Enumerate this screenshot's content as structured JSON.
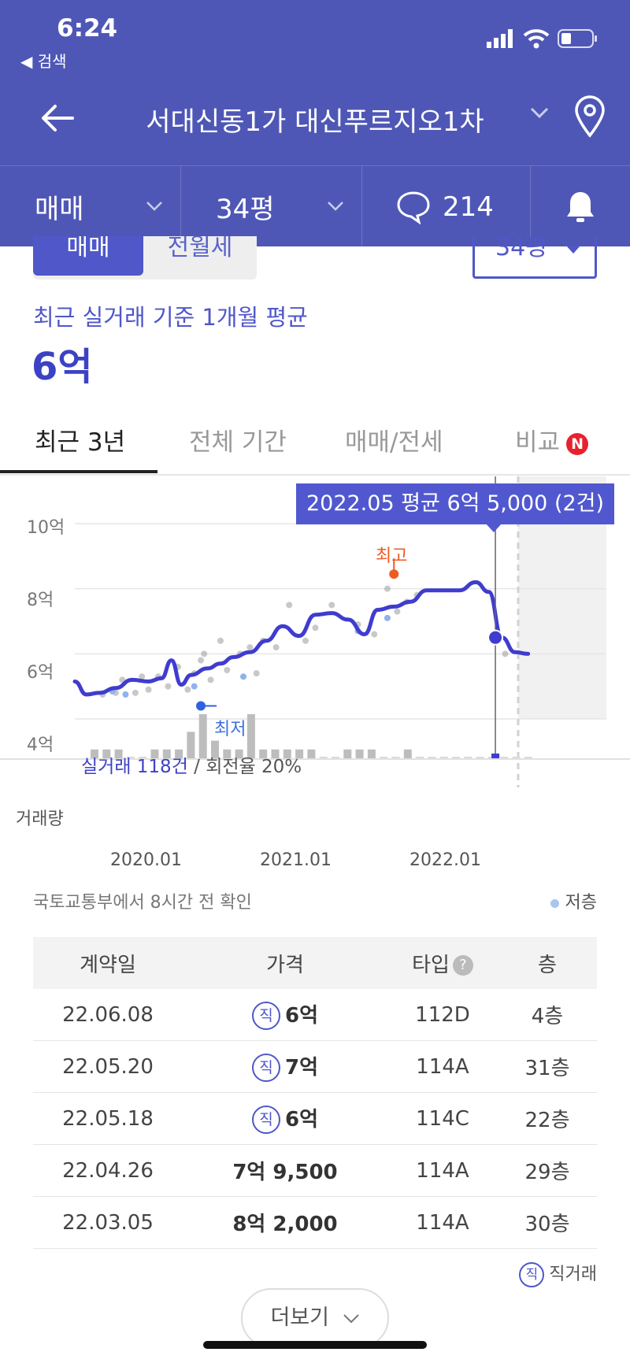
{
  "status": {
    "time": "6:24",
    "back_app": "◀ 검색"
  },
  "header": {
    "title": "서대신동1가 대신푸르지오1차"
  },
  "filters": {
    "trade": "매매",
    "size": "34평",
    "comments": "214"
  },
  "toggle": {
    "on": "매매",
    "off": "전월세",
    "size_select": "34평"
  },
  "summary": {
    "label": "최근 실거래 기준 1개월 평균",
    "value": "6억"
  },
  "tabs": [
    {
      "label": "최근 3년"
    },
    {
      "label": "전체 기간"
    },
    {
      "label": "매매/전세"
    },
    {
      "label": "비교"
    }
  ],
  "tab_badge": "N",
  "chart": {
    "tooltip": "2022.05 평균 6억 5,000 (2건)",
    "high_label": "최고",
    "low_label": "최저",
    "stats_count": "실거래 118건",
    "stats_rate": " / 회전율 20%",
    "volume_label": "거래량",
    "source": "국토교통부에서 8시간 전 확인",
    "legend_low": "저층"
  },
  "chart_data": {
    "type": "line",
    "y_axis_labels": [
      "10억",
      "8억",
      "6억",
      "4억"
    ],
    "x_axis_labels": [
      "2020.01",
      "2021.01",
      "2022.01"
    ],
    "ylim": [
      4,
      10
    ],
    "x_range": [
      2019.55,
      2022.75
    ],
    "average_line": [
      [
        2019.55,
        5.15
      ],
      [
        2019.62,
        4.75
      ],
      [
        2019.7,
        4.8
      ],
      [
        2019.8,
        4.95
      ],
      [
        2019.9,
        5.2
      ],
      [
        2020.0,
        5.15
      ],
      [
        2020.08,
        5.25
      ],
      [
        2020.14,
        5.8
      ],
      [
        2020.2,
        5.05
      ],
      [
        2020.26,
        5.35
      ],
      [
        2020.36,
        5.55
      ],
      [
        2020.44,
        5.7
      ],
      [
        2020.52,
        5.9
      ],
      [
        2020.62,
        6.05
      ],
      [
        2020.72,
        6.4
      ],
      [
        2020.82,
        6.85
      ],
      [
        2020.92,
        6.55
      ],
      [
        2021.02,
        7.2
      ],
      [
        2021.12,
        7.25
      ],
      [
        2021.22,
        7.05
      ],
      [
        2021.32,
        6.6
      ],
      [
        2021.4,
        7.35
      ],
      [
        2021.5,
        7.45
      ],
      [
        2021.6,
        7.6
      ],
      [
        2021.7,
        7.95
      ],
      [
        2021.8,
        7.95
      ],
      [
        2021.9,
        7.95
      ],
      [
        2022.0,
        8.2
      ],
      [
        2022.08,
        7.9
      ],
      [
        2022.16,
        6.5
      ],
      [
        2022.24,
        6.05
      ],
      [
        2022.32,
        6.0
      ]
    ],
    "trades": [
      [
        2019.72,
        4.75
      ],
      [
        2019.8,
        4.8
      ],
      [
        2019.84,
        5.2
      ],
      [
        2019.92,
        4.8
      ],
      [
        2019.96,
        5.3
      ],
      [
        2020.0,
        4.9
      ],
      [
        2020.06,
        5.3
      ],
      [
        2020.12,
        5.0
      ],
      [
        2020.18,
        5.6
      ],
      [
        2020.24,
        4.9
      ],
      [
        2020.28,
        5.4
      ],
      [
        2020.32,
        5.8
      ],
      [
        2020.34,
        6.0
      ],
      [
        2020.38,
        5.2
      ],
      [
        2020.44,
        6.4
      ],
      [
        2020.48,
        5.5
      ],
      [
        2020.56,
        6.0
      ],
      [
        2020.62,
        6.2
      ],
      [
        2020.66,
        5.4
      ],
      [
        2020.7,
        6.4
      ],
      [
        2020.78,
        6.2
      ],
      [
        2020.86,
        7.5
      ],
      [
        2020.96,
        6.4
      ],
      [
        2021.02,
        6.8
      ],
      [
        2021.12,
        7.5
      ],
      [
        2021.28,
        6.9
      ],
      [
        2021.38,
        6.6
      ],
      [
        2021.46,
        8.0
      ],
      [
        2021.52,
        7.3
      ],
      [
        2021.58,
        7.6
      ],
      [
        2021.64,
        7.8
      ],
      [
        2022.18,
        6.0
      ]
    ],
    "low_floor_trades": [
      [
        2019.78,
        4.85
      ],
      [
        2019.86,
        4.75
      ],
      [
        2020.28,
        5.0
      ],
      [
        2020.58,
        5.3
      ],
      [
        2021.28,
        6.7
      ],
      [
        2021.46,
        7.1
      ]
    ],
    "high_point": [
      2021.5,
      8.45
    ],
    "low_point": [
      2020.32,
      4.4
    ],
    "selected": [
      2022.12,
      6.5
    ],
    "volumes": [
      1,
      1,
      1,
      0,
      0,
      1,
      1,
      1,
      3,
      5,
      2,
      1,
      1,
      5,
      1,
      1,
      1,
      1,
      1,
      0,
      0,
      1,
      1,
      1,
      0,
      0,
      1,
      0,
      0,
      0,
      0,
      0,
      0,
      0,
      0,
      0,
      0
    ]
  },
  "table": {
    "headers": [
      "계약일",
      "가격",
      "타입",
      "층"
    ],
    "help_icon": "?",
    "direct_mark": "직",
    "rows": [
      {
        "date": "22.06.08",
        "price": "6억",
        "direct": "직",
        "type": "112D",
        "floor": "4층"
      },
      {
        "date": "22.05.20",
        "price": "7억",
        "direct": "직",
        "type": "114A",
        "floor": "31층"
      },
      {
        "date": "22.05.18",
        "price": "6억",
        "direct": "직",
        "type": "114C",
        "floor": "22층"
      },
      {
        "date": "22.04.26",
        "price": "7억 9,500",
        "direct": "",
        "type": "114A",
        "floor": "29층"
      },
      {
        "date": "22.03.05",
        "price": "8억 2,000",
        "direct": "",
        "type": "114A",
        "floor": "30층"
      }
    ],
    "legend_direct": "직거래"
  },
  "more_button": "더보기"
}
